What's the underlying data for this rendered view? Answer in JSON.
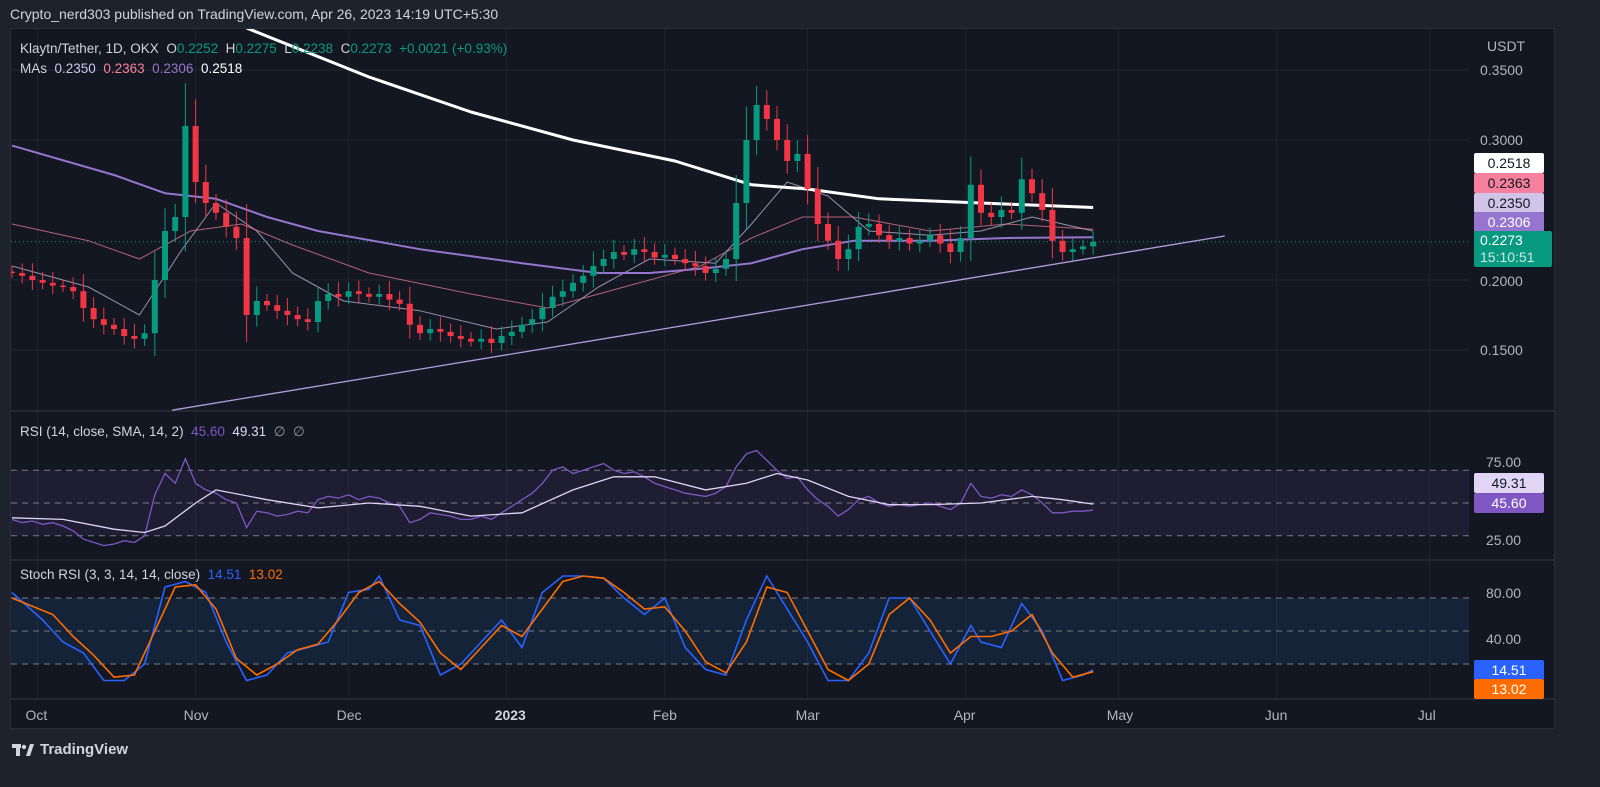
{
  "header": {
    "published": "Crypto_nerd303 published on TradingView.com, Apr 26, 2023 14:19 UTC+5:30"
  },
  "legend": {
    "symbol": "Klaytn/Tether, 1D, OKX",
    "o_label": "O",
    "o": "0.2252",
    "h_label": "H",
    "h": "0.2275",
    "l_label": "L",
    "l": "0.2238",
    "c_label": "C",
    "c": "0.2273",
    "change": "+0.0021 (+0.93%)",
    "mas_label": "MAs",
    "ma_values": [
      "0.2350",
      "0.2363",
      "0.2306",
      "0.2518"
    ]
  },
  "price_axis": {
    "unit": "USDT",
    "ticks": [
      "0.3500",
      "0.3000",
      "0.2000",
      "0.1500"
    ],
    "tags": [
      "0.2518",
      "0.2363",
      "0.2350",
      "0.2306"
    ],
    "last_price": "0.2273",
    "countdown": "15:10:51"
  },
  "rsi": {
    "title": "RSI (14, close, SMA, 14, 2)",
    "value": "45.60",
    "sma_value": "49.31",
    "na1": "∅",
    "na2": "∅",
    "ticks": [
      "75.00",
      "25.00"
    ],
    "tag_sma": "49.31",
    "tag_rsi": "45.60"
  },
  "stoch": {
    "title": "Stoch RSI (3, 3, 14, 14, close)",
    "k_value": "14.51",
    "d_value": "13.02",
    "ticks": [
      "80.00",
      "40.00"
    ],
    "tag_k": "14.51",
    "tag_d": "13.02"
  },
  "time_axis": {
    "labels": [
      "Oct",
      "Nov",
      "Dec",
      "2023",
      "Feb",
      "Mar",
      "Apr",
      "May",
      "Jun",
      "Jul"
    ]
  },
  "footer": {
    "brand": "TradingView"
  },
  "colors": {
    "up": "#089981",
    "down": "#f23645",
    "ma20": "#d1c4e9",
    "ma50": "#f7819c",
    "ma100": "#9575cd",
    "ma200": "#ffffff",
    "rsi": "#7e57c2",
    "rsi_sma": "#e1d5f5",
    "k": "#2962ff",
    "d": "#ff6d00",
    "trend": "#b39ddb"
  },
  "chart_data": {
    "type": "candlestick",
    "title": "Klaytn/Tether, 1D, OKX",
    "x_unit": "days since 2022-09-26",
    "step_days": 2,
    "closes": [
      0.205,
      0.203,
      0.2,
      0.198,
      0.196,
      0.195,
      0.192,
      0.18,
      0.172,
      0.168,
      0.165,
      0.16,
      0.158,
      0.162,
      0.2,
      0.235,
      0.245,
      0.31,
      0.27,
      0.255,
      0.248,
      0.238,
      0.23,
      0.175,
      0.185,
      0.182,
      0.178,
      0.175,
      0.172,
      0.17,
      0.185,
      0.19,
      0.188,
      0.192,
      0.19,
      0.188,
      0.19,
      0.186,
      0.183,
      0.168,
      0.162,
      0.165,
      0.163,
      0.16,
      0.158,
      0.156,
      0.158,
      0.155,
      0.16,
      0.163,
      0.168,
      0.172,
      0.18,
      0.188,
      0.192,
      0.198,
      0.203,
      0.21,
      0.215,
      0.22,
      0.218,
      0.222,
      0.22,
      0.216,
      0.218,
      0.215,
      0.212,
      0.21,
      0.205,
      0.208,
      0.215,
      0.255,
      0.3,
      0.325,
      0.315,
      0.3,
      0.285,
      0.29,
      0.265,
      0.24,
      0.228,
      0.215,
      0.222,
      0.238,
      0.24,
      0.232,
      0.228,
      0.23,
      0.226,
      0.228,
      0.232,
      0.226,
      0.22,
      0.23,
      0.268,
      0.248,
      0.245,
      0.25,
      0.248,
      0.272,
      0.262,
      0.25,
      0.228,
      0.22,
      0.222,
      0.224,
      0.2273
    ],
    "ylim": [
      0.105,
      0.38
    ],
    "moving_averages": [
      {
        "name": "MA20",
        "value": 0.235,
        "points": [
          [
            0,
            0.21
          ],
          [
            15,
            0.195
          ],
          [
            25,
            0.175
          ],
          [
            33,
            0.22
          ],
          [
            40,
            0.255
          ],
          [
            48,
            0.235
          ],
          [
            55,
            0.205
          ],
          [
            65,
            0.185
          ],
          [
            80,
            0.178
          ],
          [
            95,
            0.165
          ],
          [
            105,
            0.17
          ],
          [
            115,
            0.195
          ],
          [
            125,
            0.215
          ],
          [
            138,
            0.212
          ],
          [
            145,
            0.24
          ],
          [
            152,
            0.27
          ],
          [
            160,
            0.26
          ],
          [
            168,
            0.235
          ],
          [
            180,
            0.232
          ],
          [
            190,
            0.235
          ],
          [
            200,
            0.245
          ],
          [
            212,
            0.235
          ]
        ]
      },
      {
        "name": "MA50",
        "value": 0.2363,
        "points": [
          [
            0,
            0.24
          ],
          [
            15,
            0.228
          ],
          [
            25,
            0.215
          ],
          [
            35,
            0.235
          ],
          [
            45,
            0.24
          ],
          [
            55,
            0.225
          ],
          [
            70,
            0.205
          ],
          [
            90,
            0.19
          ],
          [
            105,
            0.18
          ],
          [
            120,
            0.195
          ],
          [
            135,
            0.21
          ],
          [
            145,
            0.23
          ],
          [
            155,
            0.245
          ],
          [
            165,
            0.245
          ],
          [
            180,
            0.235
          ],
          [
            195,
            0.24
          ],
          [
            212,
            0.2363
          ]
        ]
      },
      {
        "name": "MA100",
        "value": 0.2306,
        "points": [
          [
            0,
            0.296
          ],
          [
            20,
            0.275
          ],
          [
            30,
            0.262
          ],
          [
            40,
            0.258
          ],
          [
            50,
            0.245
          ],
          [
            60,
            0.235
          ],
          [
            80,
            0.222
          ],
          [
            100,
            0.212
          ],
          [
            115,
            0.205
          ],
          [
            125,
            0.205
          ],
          [
            135,
            0.208
          ],
          [
            145,
            0.212
          ],
          [
            155,
            0.222
          ],
          [
            165,
            0.228
          ],
          [
            180,
            0.228
          ],
          [
            195,
            0.23
          ],
          [
            212,
            0.2306
          ]
        ]
      },
      {
        "name": "MA200",
        "value": 0.2518,
        "points": [
          [
            46,
            0.38
          ],
          [
            70,
            0.345
          ],
          [
            90,
            0.32
          ],
          [
            110,
            0.3
          ],
          [
            130,
            0.285
          ],
          [
            145,
            0.268
          ],
          [
            156,
            0.265
          ],
          [
            170,
            0.258
          ],
          [
            190,
            0.255
          ],
          [
            212,
            0.2518
          ]
        ]
      }
    ],
    "trendline": [
      [
        31.4,
        0.107
      ],
      [
        237.8,
        0.2314
      ]
    ],
    "rsi": {
      "ylim": [
        20,
        85
      ],
      "bands": [
        30,
        50,
        70
      ],
      "values": [
        40,
        38,
        39,
        37,
        38,
        36,
        33,
        28,
        26,
        24,
        25,
        27,
        26,
        30,
        55,
        68,
        62,
        77,
        62,
        58,
        56,
        52,
        50,
        35,
        45,
        44,
        42,
        43,
        45,
        44,
        52,
        54,
        53,
        55,
        52,
        54,
        53,
        50,
        48,
        38,
        40,
        44,
        43,
        42,
        40,
        40,
        42,
        40,
        44,
        48,
        52,
        56,
        62,
        70,
        72,
        68,
        70,
        72,
        74,
        70,
        68,
        69,
        66,
        62,
        60,
        58,
        56,
        55,
        54,
        56,
        60,
        72,
        80,
        82,
        76,
        70,
        65,
        66,
        58,
        52,
        48,
        42,
        46,
        52,
        54,
        50,
        48,
        49,
        48,
        49,
        50,
        48,
        46,
        50,
        62,
        54,
        53,
        55,
        54,
        58,
        55,
        50,
        44,
        44,
        45,
        45,
        45.6
      ],
      "sma_points": [
        [
          0,
          41
        ],
        [
          10,
          40
        ],
        [
          20,
          34
        ],
        [
          26,
          32
        ],
        [
          30,
          36
        ],
        [
          36,
          50
        ],
        [
          40,
          58
        ],
        [
          50,
          52
        ],
        [
          60,
          47
        ],
        [
          70,
          50
        ],
        [
          80,
          48
        ],
        [
          90,
          42
        ],
        [
          100,
          44
        ],
        [
          110,
          58
        ],
        [
          118,
          66
        ],
        [
          126,
          66
        ],
        [
          136,
          58
        ],
        [
          144,
          62
        ],
        [
          150,
          68
        ],
        [
          156,
          64
        ],
        [
          164,
          54
        ],
        [
          172,
          49
        ],
        [
          180,
          49
        ],
        [
          190,
          50
        ],
        [
          200,
          54
        ],
        [
          206,
          52
        ],
        [
          212,
          49.31
        ]
      ]
    },
    "stoch_rsi": {
      "ylim": [
        0,
        100
      ],
      "bands": [
        20,
        50,
        80
      ],
      "k_points": [
        [
          0,
          85
        ],
        [
          6,
          60
        ],
        [
          10,
          40
        ],
        [
          14,
          30
        ],
        [
          18,
          5
        ],
        [
          22,
          5
        ],
        [
          26,
          20
        ],
        [
          30,
          90
        ],
        [
          34,
          95
        ],
        [
          38,
          85
        ],
        [
          42,
          40
        ],
        [
          46,
          5
        ],
        [
          50,
          10
        ],
        [
          54,
          30
        ],
        [
          58,
          35
        ],
        [
          62,
          40
        ],
        [
          66,
          85
        ],
        [
          70,
          88
        ],
        [
          72,
          100
        ],
        [
          76,
          60
        ],
        [
          80,
          55
        ],
        [
          84,
          10
        ],
        [
          88,
          20
        ],
        [
          92,
          40
        ],
        [
          96,
          60
        ],
        [
          100,
          35
        ],
        [
          104,
          85
        ],
        [
          108,
          100
        ],
        [
          112,
          100
        ],
        [
          116,
          98
        ],
        [
          120,
          80
        ],
        [
          124,
          65
        ],
        [
          128,
          80
        ],
        [
          132,
          35
        ],
        [
          136,
          15
        ],
        [
          140,
          10
        ],
        [
          144,
          60
        ],
        [
          148,
          100
        ],
        [
          152,
          70
        ],
        [
          156,
          40
        ],
        [
          160,
          5
        ],
        [
          164,
          5
        ],
        [
          168,
          30
        ],
        [
          172,
          80
        ],
        [
          176,
          80
        ],
        [
          180,
          50
        ],
        [
          184,
          20
        ],
        [
          188,
          55
        ],
        [
          190,
          40
        ],
        [
          194,
          35
        ],
        [
          198,
          75
        ],
        [
          202,
          50
        ],
        [
          206,
          5
        ],
        [
          210,
          10
        ],
        [
          212,
          14.51
        ]
      ],
      "d_points": [
        [
          0,
          80
        ],
        [
          8,
          65
        ],
        [
          12,
          45
        ],
        [
          16,
          28
        ],
        [
          20,
          8
        ],
        [
          24,
          10
        ],
        [
          28,
          50
        ],
        [
          32,
          90
        ],
        [
          36,
          92
        ],
        [
          40,
          70
        ],
        [
          44,
          25
        ],
        [
          48,
          10
        ],
        [
          52,
          20
        ],
        [
          56,
          33
        ],
        [
          60,
          38
        ],
        [
          64,
          60
        ],
        [
          68,
          85
        ],
        [
          72,
          95
        ],
        [
          76,
          75
        ],
        [
          80,
          58
        ],
        [
          84,
          30
        ],
        [
          88,
          15
        ],
        [
          92,
          35
        ],
        [
          96,
          55
        ],
        [
          100,
          45
        ],
        [
          104,
          70
        ],
        [
          108,
          95
        ],
        [
          112,
          100
        ],
        [
          116,
          98
        ],
        [
          120,
          85
        ],
        [
          124,
          70
        ],
        [
          128,
          72
        ],
        [
          132,
          50
        ],
        [
          136,
          22
        ],
        [
          140,
          12
        ],
        [
          144,
          40
        ],
        [
          148,
          90
        ],
        [
          152,
          85
        ],
        [
          156,
          50
        ],
        [
          160,
          15
        ],
        [
          164,
          5
        ],
        [
          168,
          20
        ],
        [
          172,
          65
        ],
        [
          176,
          80
        ],
        [
          180,
          60
        ],
        [
          184,
          30
        ],
        [
          188,
          45
        ],
        [
          192,
          45
        ],
        [
          196,
          50
        ],
        [
          200,
          65
        ],
        [
          204,
          30
        ],
        [
          208,
          8
        ],
        [
          212,
          13.02
        ]
      ]
    },
    "x_tick_days": [
      5,
      36,
      66,
      97,
      128,
      156,
      187,
      217,
      248,
      278
    ],
    "price_ticks": [
      0.35,
      0.3,
      0.2,
      0.15
    ]
  }
}
